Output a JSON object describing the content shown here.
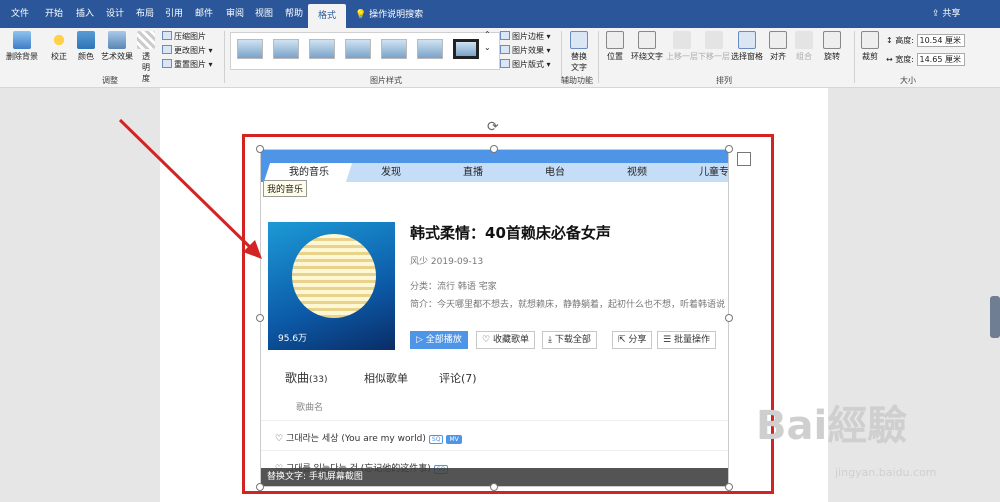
{
  "tabs": [
    "文件",
    "开始",
    "插入",
    "设计",
    "布局",
    "引用",
    "邮件",
    "审阅",
    "视图",
    "帮助",
    "格式"
  ],
  "tell_me": "操作说明搜索",
  "share": "共享",
  "ribbon": {
    "adjust": {
      "remove_bg": "删除背景",
      "correct": "校正",
      "color": "颜色",
      "art": "艺术效果",
      "transparency": "透明度",
      "compress": "压缩图片",
      "change": "更改图片",
      "reset": "重置图片",
      "label": "调整"
    },
    "styles": {
      "label": "图片样式",
      "border": "图片边框",
      "effects": "图片效果",
      "layout": "图片版式"
    },
    "access": {
      "alt": "替换文字",
      "label": "辅助功能"
    },
    "arrange": {
      "position": "位置",
      "wrap": "环绕文字",
      "forward": "上移一层",
      "backward": "下移一层",
      "pane": "选择窗格",
      "align": "对齐",
      "group": "组合",
      "rotate": "旋转",
      "label": "排列"
    },
    "size": {
      "crop": "裁剪",
      "height_label": "高度:",
      "height": "10.54 厘米",
      "width_label": "宽度:",
      "width": "14.65 厘米",
      "label": "大小"
    }
  },
  "music": {
    "nav": [
      "我的音乐",
      "发现",
      "直播",
      "电台",
      "视频",
      "儿童专区"
    ],
    "tooltip": "我的音乐",
    "title": "韩式柔情：40首赖床必备女声",
    "author": "风少",
    "date": "2019-09-13",
    "category_label": "分类：",
    "categories": [
      "流行",
      "韩语",
      "宅家"
    ],
    "intro": "简介：今天哪里都不想去，就想赖床，静静躺着，起初什么也不想，听着韩语说",
    "plays": "95.6万",
    "actions": [
      "全部播放",
      "收藏歌单",
      "下载全部",
      "分享",
      "批量操作"
    ],
    "subtabs": {
      "songs": "歌曲",
      "count": "(33)",
      "similar": "相似歌单",
      "comments": "评论(7)"
    },
    "col_song": "歌曲名",
    "songs": [
      {
        "name": "그대라는 세상 (You are my world)",
        "badges": [
          "SQ",
          "MV"
        ]
      },
      {
        "name": "그대를 잊는다는 건 (忘记他的这件事)",
        "badges": [
          "SQ"
        ]
      }
    ],
    "alt_text": "替换文字: 手机屏幕截图"
  },
  "watermark": "Bai經驗",
  "watermark_url": "jingyan.baidu.com"
}
